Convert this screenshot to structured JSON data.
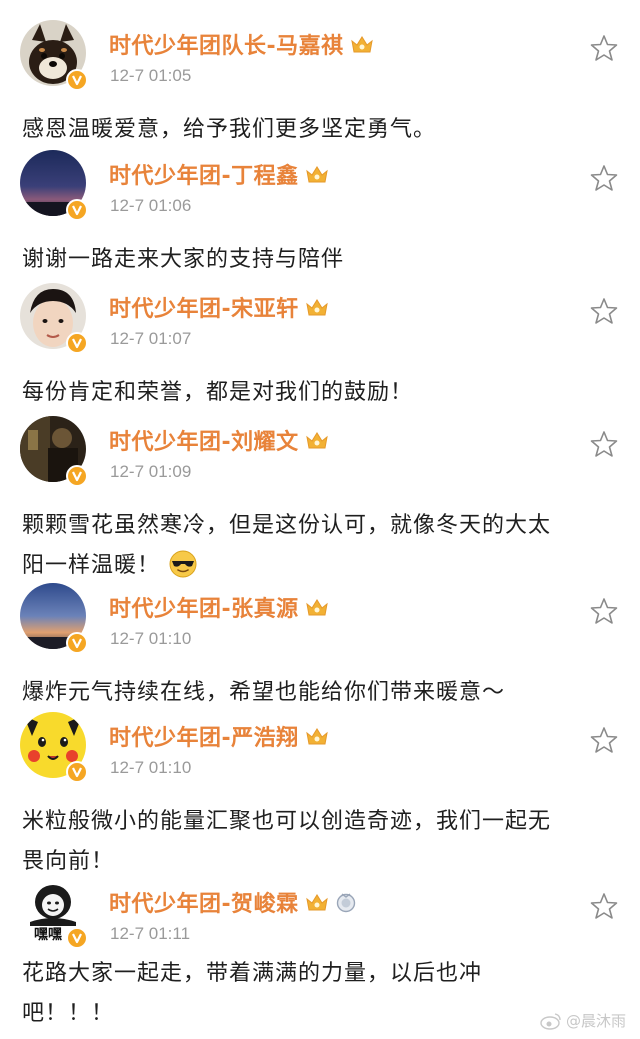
{
  "comments": [
    {
      "username": "时代少年团队长-马嘉祺",
      "time": "12-7 01:05",
      "text_lines": [
        "感恩温暖爱意，给予我们更多坚定勇气。"
      ],
      "avatar": "shiba-dog-avatar",
      "badges": [
        "crown-badge-icon"
      ]
    },
    {
      "username": "时代少年团-丁程鑫",
      "time": "12-7 01:06",
      "text_lines": [
        "谢谢一路走来大家的支持与陪伴"
      ],
      "avatar": "dusk-sky-avatar",
      "badges": [
        "crown-badge-icon"
      ]
    },
    {
      "username": "时代少年团-宋亚轩",
      "time": "12-7 01:07",
      "text_lines": [
        "每份肯定和荣誉，都是对我们的鼓励！"
      ],
      "avatar": "boy-selfie-avatar",
      "badges": [
        "crown-badge-icon"
      ]
    },
    {
      "username": "时代少年团-刘耀文",
      "time": "12-7 01:09",
      "text_lines": [
        "颗颗雪花虽然寒冷，但是这份认可，就像冬天的大太",
        "阳一样温暖！"
      ],
      "avatar": "dark-photo-avatar",
      "badges": [
        "crown-badge-icon"
      ],
      "emoji": "sunglasses-emoji-icon"
    },
    {
      "username": "时代少年团-张真源",
      "time": "12-7 01:10",
      "text_lines": [
        "爆炸元气持续在线，希望也能给你们带来暖意～"
      ],
      "avatar": "sunset-sky-avatar",
      "badges": [
        "crown-badge-icon"
      ]
    },
    {
      "username": "时代少年团-严浩翔",
      "time": "12-7 01:10",
      "text_lines": [
        "米粒般微小的能量汇聚也可以创造奇迹，我们一起无",
        "畏向前！"
      ],
      "avatar": "pikachu-avatar",
      "badges": [
        "crown-badge-icon"
      ]
    },
    {
      "username": "时代少年团-贺峻霖",
      "time": "12-7 01:11",
      "text_lines": [
        "花路大家一起走，带着满满的力量，以后也冲",
        "吧！！！"
      ],
      "avatar": "meme-face-avatar",
      "avatar_caption": "嘿嘿",
      "badges": [
        "crown-badge-icon",
        "medal-badge-icon"
      ]
    }
  ],
  "watermark": {
    "text": "@晨沐雨",
    "icon": "weibo-logo-icon"
  },
  "colors": {
    "username": "#e8833a",
    "timestamp": "#9a9a9a",
    "body_text": "#1f1f1f",
    "verified_badge": "#f5a623",
    "crown_badge": "#f2b134",
    "star_outline": "#8a8a8a"
  }
}
